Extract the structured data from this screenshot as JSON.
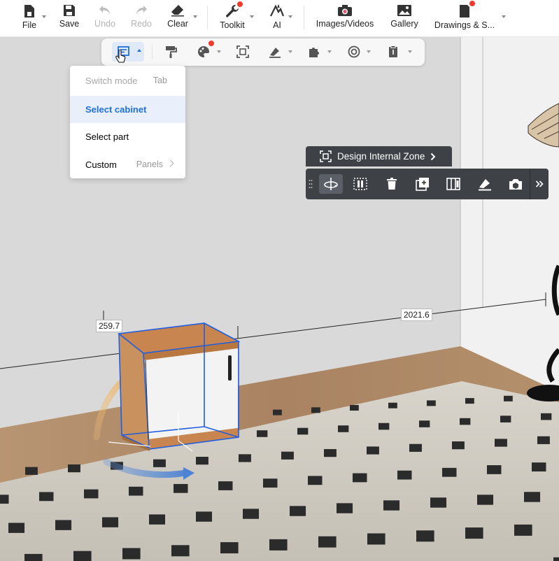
{
  "toolbar": {
    "file": "File",
    "save": "Save",
    "undo": "Undo",
    "redo": "Redo",
    "clear": "Clear",
    "toolkit": "Toolkit",
    "ai": "AI",
    "images_videos": "Images/Videos",
    "gallery": "Gallery",
    "drawings": "Drawings & S..."
  },
  "dropdown": {
    "switch_mode": "Switch mode",
    "switch_mode_key": "Tab",
    "select_cabinet": "Select cabinet",
    "select_part": "Select part",
    "custom": "Custom",
    "custom_sub": "Panels"
  },
  "design_zone": {
    "title": "Design Internal Zone"
  },
  "dimensions": {
    "depth": "259.7",
    "wall_length": "2021.6"
  },
  "colors": {
    "accent": "#1f6fdb",
    "dark_toolbar": "#3e4247",
    "notification": "#f23a2b"
  }
}
